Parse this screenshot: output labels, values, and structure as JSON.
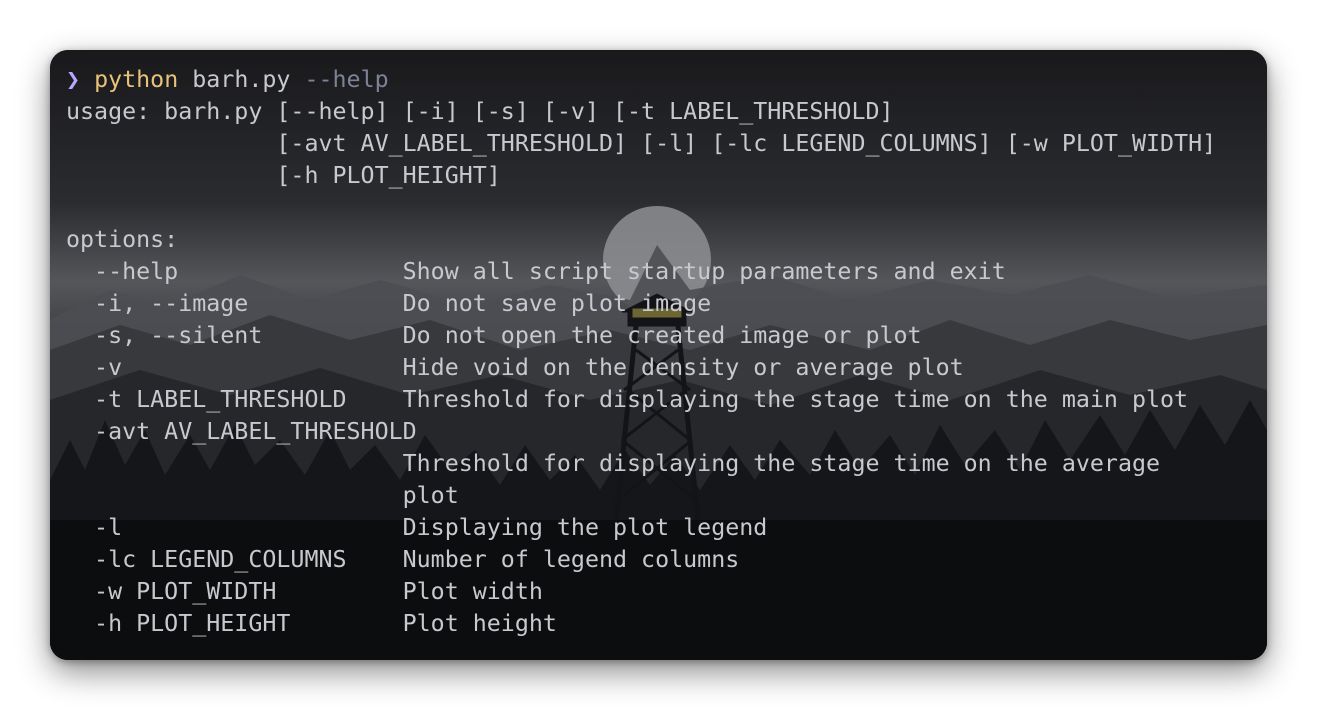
{
  "prompt": {
    "symbol": "❯",
    "command": "python",
    "script": "barh.py",
    "flag": "--help"
  },
  "usage": [
    "usage: barh.py [--help] [-i] [-s] [-v] [-t LABEL_THRESHOLD]",
    "               [-avt AV_LABEL_THRESHOLD] [-l] [-lc LEGEND_COLUMNS] [-w PLOT_WIDTH]",
    "               [-h PLOT_HEIGHT]"
  ],
  "options_header": "options:",
  "options": [
    "  --help                Show all script startup parameters and exit",
    "  -i, --image           Do not save plot image",
    "  -s, --silent          Do not open the created image or plot",
    "  -v                    Hide void on the density or average plot",
    "  -t LABEL_THRESHOLD    Threshold for displaying the stage time on the main plot",
    "  -avt AV_LABEL_THRESHOLD",
    "                        Threshold for displaying the stage time on the average",
    "                        plot",
    "  -l                    Displaying the plot legend",
    "  -lc LEGEND_COLUMNS    Number of legend columns",
    "  -w PLOT_WIDTH         Plot width",
    "  -h PLOT_HEIGHT        Plot height"
  ],
  "colors": {
    "prompt_symbol": "#b9a7ff",
    "command": "#e8c27a",
    "flag": "#7d8296",
    "text": "#c7c9cf"
  }
}
